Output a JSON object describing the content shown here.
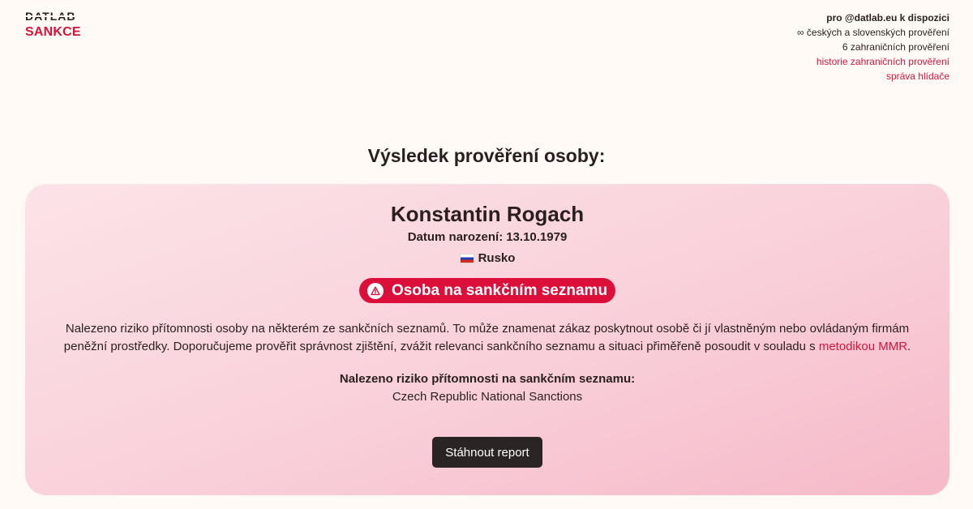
{
  "brand": {
    "name_top": "DATLAB",
    "name_bottom": "SANKCE"
  },
  "account": {
    "line1": "pro @datlab.eu k dispozici",
    "line2": "∞ českých a slovenských prověření",
    "line3": "6 zahraničních prověření",
    "link_history": "historie zahraničních prověření",
    "link_watchdog": "správa hlídače"
  },
  "page_title": "Výsledek prověření osoby:",
  "result": {
    "name": "Konstantin Rogach",
    "dob_label": "Datum narození:",
    "dob_value": "13.10.1979",
    "country": "Rusko",
    "badge": "Osoba na sankčním seznamu",
    "description": "Nalezeno riziko přítomnosti osoby na některém ze sankčních seznamů. To může znamenat zákaz poskytnout osobě či jí vlastněným nebo ovládaným firmám peněžní prostředky. Doporučujeme prověřit správnost zjištění, zvážit relevanci sankčního seznamu a situaci přiměřeně posoudit v souladu s ",
    "description_link": "metodikou MMR",
    "description_end": ".",
    "found_label": "Nalezeno riziko přítomnosti na sankčním seznamu:",
    "found_list": "Czech Republic National Sanctions",
    "download_label": "Stáhnout report"
  },
  "icons": {
    "badge": "warning-triangle-icon",
    "flag": "russia-flag-icon"
  },
  "colors": {
    "accent": "#d6143b",
    "badge_bg": "#dc0f3b",
    "button_bg": "#2b2425",
    "page_bg": "#fffaf6",
    "card_bg": "#f9d0da"
  }
}
